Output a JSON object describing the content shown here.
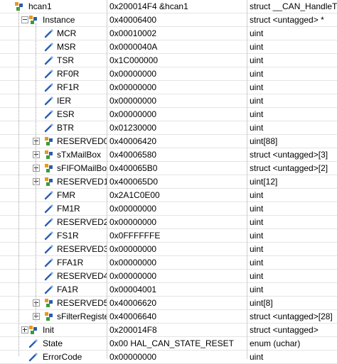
{
  "watch_rows": [
    {
      "name": "hcan1",
      "value": "0x200014F4 &hcan1",
      "type": "struct __CAN_HandleT...",
      "level": 0,
      "expander": "none",
      "icon": "struct-icon"
    },
    {
      "name": "Instance",
      "value": "0x40006400",
      "type": "struct <untagged> *",
      "level": 1,
      "expander": "minus",
      "icon": "struct-icon"
    },
    {
      "name": "MCR",
      "value": "0x00010002",
      "type": "uint",
      "level": 2,
      "expander": "none",
      "icon": "variable-icon"
    },
    {
      "name": "MSR",
      "value": "0x0000040A",
      "type": "uint",
      "level": 2,
      "expander": "none",
      "icon": "variable-icon"
    },
    {
      "name": "TSR",
      "value": "0x1C000000",
      "type": "uint",
      "level": 2,
      "expander": "none",
      "icon": "variable-icon"
    },
    {
      "name": "RF0R",
      "value": "0x00000000",
      "type": "uint",
      "level": 2,
      "expander": "none",
      "icon": "variable-icon"
    },
    {
      "name": "RF1R",
      "value": "0x00000000",
      "type": "uint",
      "level": 2,
      "expander": "none",
      "icon": "variable-icon"
    },
    {
      "name": "IER",
      "value": "0x00000000",
      "type": "uint",
      "level": 2,
      "expander": "none",
      "icon": "variable-icon"
    },
    {
      "name": "ESR",
      "value": "0x00000000",
      "type": "uint",
      "level": 2,
      "expander": "none",
      "icon": "variable-icon"
    },
    {
      "name": "BTR",
      "value": "0x01230000",
      "type": "uint",
      "level": 2,
      "expander": "none",
      "icon": "variable-icon"
    },
    {
      "name": "RESERVED0",
      "value": "0x40006420",
      "type": "uint[88]",
      "level": 2,
      "expander": "plus",
      "icon": "struct-icon"
    },
    {
      "name": "sTxMailBox",
      "value": "0x40006580",
      "type": "struct <untagged>[3]",
      "level": 2,
      "expander": "plus",
      "icon": "struct-icon"
    },
    {
      "name": "sFIFOMailBox",
      "value": "0x400065B0",
      "type": "struct <untagged>[2]",
      "level": 2,
      "expander": "plus",
      "icon": "struct-icon"
    },
    {
      "name": "RESERVED1",
      "value": "0x400065D0",
      "type": "uint[12]",
      "level": 2,
      "expander": "plus",
      "icon": "struct-icon"
    },
    {
      "name": "FMR",
      "value": "0x2A1C0E00",
      "type": "uint",
      "level": 2,
      "expander": "none",
      "icon": "variable-icon"
    },
    {
      "name": "FM1R",
      "value": "0x00000000",
      "type": "uint",
      "level": 2,
      "expander": "none",
      "icon": "variable-icon"
    },
    {
      "name": "RESERVED2",
      "value": "0x00000000",
      "type": "uint",
      "level": 2,
      "expander": "none",
      "icon": "variable-icon"
    },
    {
      "name": "FS1R",
      "value": "0x0FFFFFFE",
      "type": "uint",
      "level": 2,
      "expander": "none",
      "icon": "variable-icon"
    },
    {
      "name": "RESERVED3",
      "value": "0x00000000",
      "type": "uint",
      "level": 2,
      "expander": "none",
      "icon": "variable-icon"
    },
    {
      "name": "FFA1R",
      "value": "0x00000000",
      "type": "uint",
      "level": 2,
      "expander": "none",
      "icon": "variable-icon"
    },
    {
      "name": "RESERVED4",
      "value": "0x00000000",
      "type": "uint",
      "level": 2,
      "expander": "none",
      "icon": "variable-icon"
    },
    {
      "name": "FA1R",
      "value": "0x00004001",
      "type": "uint",
      "level": 2,
      "expander": "none",
      "icon": "variable-icon"
    },
    {
      "name": "RESERVED5",
      "value": "0x40006620",
      "type": "uint[8]",
      "level": 2,
      "expander": "plus",
      "icon": "struct-icon"
    },
    {
      "name": "sFilterRegister",
      "value": "0x40006640",
      "type": "struct <untagged>[28]",
      "level": 2,
      "expander": "plus",
      "icon": "struct-icon"
    },
    {
      "name": "Init",
      "value": "0x200014F8",
      "type": "struct <untagged>",
      "level": 1,
      "expander": "plus",
      "icon": "struct-icon"
    },
    {
      "name": "State",
      "value": "0x00 HAL_CAN_STATE_RESET",
      "type": "enum (uchar)",
      "level": 1,
      "expander": "none",
      "icon": "variable-icon"
    },
    {
      "name": "ErrorCode",
      "value": "0x00000000",
      "type": "uint",
      "level": 1,
      "expander": "none",
      "icon": "variable-icon"
    }
  ],
  "colors": {
    "icon_blue": "#2a5db0",
    "icon_orange": "#e59a1c",
    "icon_green": "#3a9a3a",
    "grid_line": "#e4e4e4"
  }
}
